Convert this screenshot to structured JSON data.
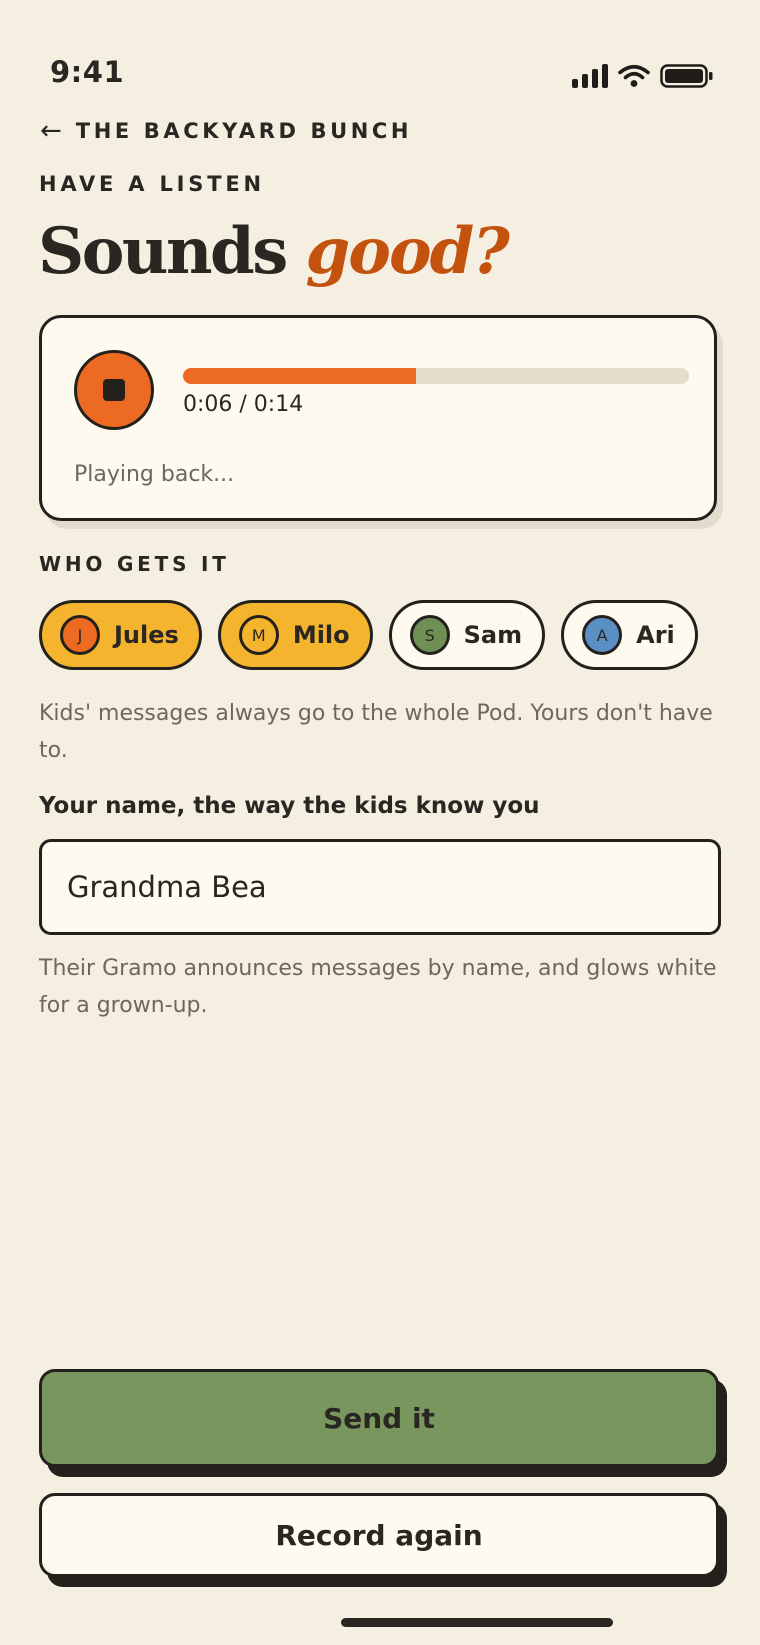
{
  "status_bar": {
    "time": "9:41"
  },
  "nav": {
    "back_label": "THE BACKYARD BUNCH"
  },
  "eyebrow": "HAVE A LISTEN",
  "headline": {
    "main": "Sounds",
    "accent": "good?"
  },
  "player": {
    "time_readout": "0:06 / 0:14",
    "progress_fraction": 0.46,
    "status": "Playing back..."
  },
  "recipients": {
    "label": "WHO GETS IT",
    "chips": [
      {
        "initial": "J",
        "name": "Jules",
        "selected": true,
        "avatar_color": "#ec6a22"
      },
      {
        "initial": "M",
        "name": "Milo",
        "selected": true,
        "avatar_color": "#f5b42e"
      },
      {
        "initial": "S",
        "name": "Sam",
        "selected": false,
        "avatar_color": "#6f8f55"
      },
      {
        "initial": "A",
        "name": "Ari",
        "selected": false,
        "avatar_color": "#5a8fc4"
      }
    ],
    "helper": "Kids' messages always go to the whole Pod. Yours don't have to."
  },
  "name_field": {
    "label": "Your name, the way the kids know you",
    "value": "Grandma Bea",
    "helper": "Their Gramo announces messages by name, and glows white for a grown-up."
  },
  "actions": {
    "send": "Send it",
    "record_again": "Record again"
  },
  "colors": {
    "accent": "#ec6a22",
    "headline_accent": "#c4520f",
    "selected_chip": "#f5b42e",
    "send_button": "#79965e",
    "background": "#f5efe1"
  }
}
